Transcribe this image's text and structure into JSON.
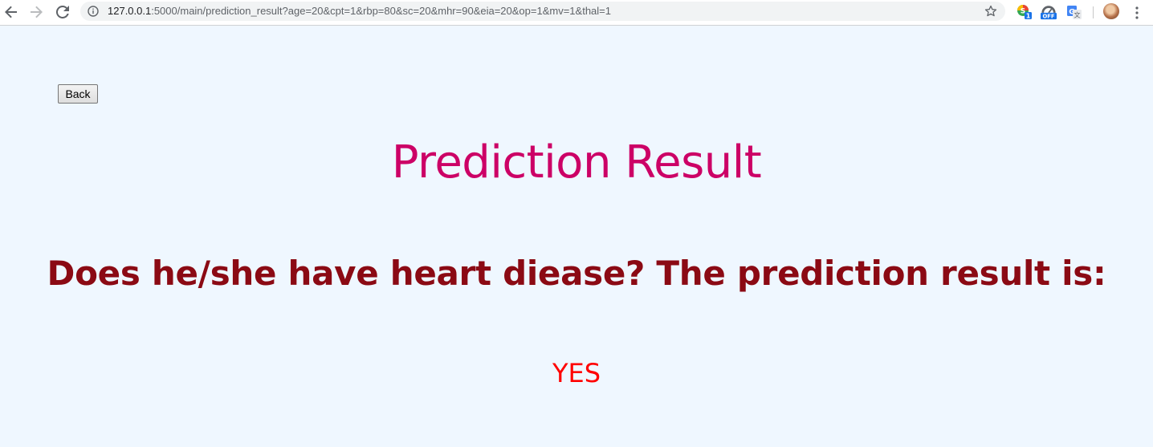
{
  "browser": {
    "url_host": "127.0.0.1",
    "url_rest": ":5000/main/prediction_result?age=20&cpt=1&rbp=80&sc=20&mhr=90&eia=20&op=1&mv=1&thal=1",
    "extensions": [
      {
        "name": "sheets-extension-icon",
        "badge": "1"
      },
      {
        "name": "speed-extension-icon",
        "badge": "OFF"
      },
      {
        "name": "translate-extension-icon"
      }
    ]
  },
  "page": {
    "back_label": "Back",
    "title": "Prediction Result",
    "question": "Does he/she have heart diease? The prediction result is:",
    "result": "YES"
  },
  "colors": {
    "background": "#eff7ff",
    "title": "#cc0066",
    "question": "#8b0a14",
    "result": "#ff0000"
  }
}
